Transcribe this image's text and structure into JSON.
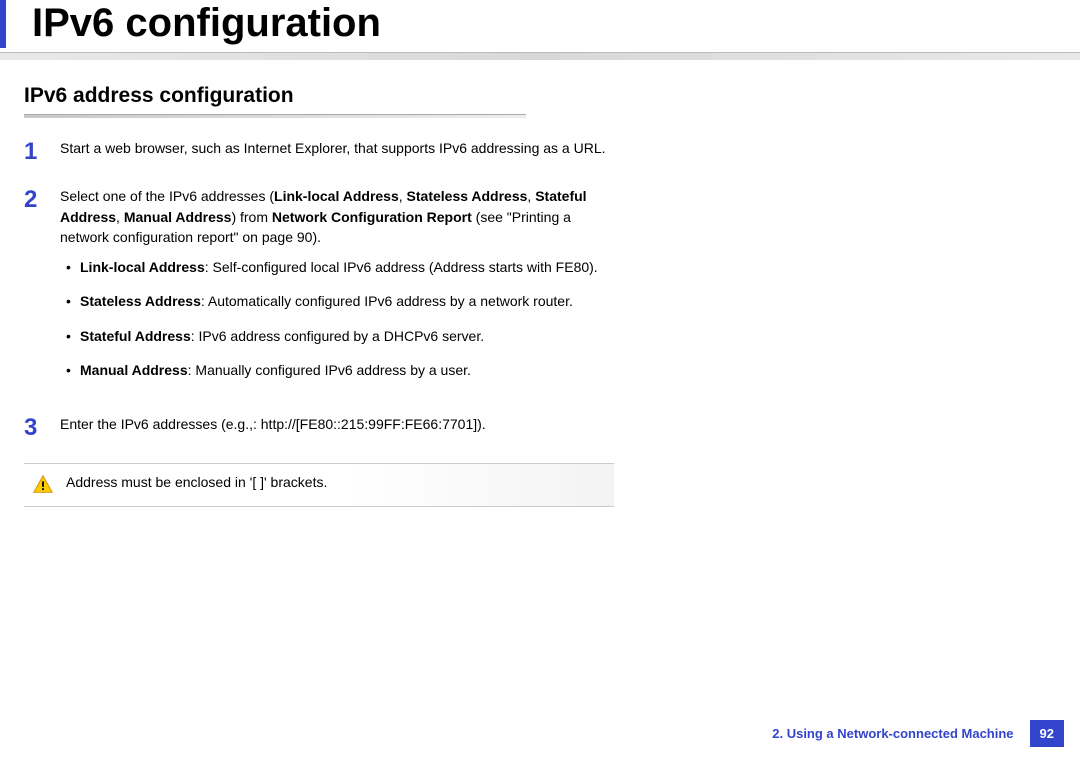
{
  "title": "IPv6 configuration",
  "section_heading": "IPv6 address configuration",
  "steps": {
    "s1": {
      "num": "1",
      "text": "Start a web browser, such as Internet Explorer, that supports IPv6 addressing as a URL."
    },
    "s2": {
      "num": "2",
      "lead_a": "Select one of the IPv6 addresses (",
      "bold1": "Link-local Address",
      "sep1": ", ",
      "bold2": "Stateless Address",
      "sep2": ", ",
      "bold3": "Stateful Address",
      "sep3": ", ",
      "bold4": "Manual Address",
      "lead_b": ") from ",
      "bold5": "Network Configuration Report",
      "tail": " (see \"Printing a network configuration report\" on page 90).",
      "bullets": {
        "b1_bold": "Link-local Address",
        "b1_rest": ": Self-configured local IPv6 address (Address starts with FE80).",
        "b2_bold": "Stateless Address",
        "b2_rest": ": Automatically configured IPv6 address by a network router.",
        "b3_bold": "Stateful Address",
        "b3_rest": ": IPv6 address configured by a DHCPv6 server.",
        "b4_bold": "Manual Address",
        "b4_rest": ": Manually configured IPv6 address by a user."
      }
    },
    "s3": {
      "num": "3",
      "text": "Enter the IPv6 addresses (e.g.,: http://[FE80::215:99FF:FE66:7701])."
    }
  },
  "note": "Address must be enclosed in '[ ]' brackets.",
  "footer": {
    "chapter": "2.  Using a Network-connected Machine",
    "page": "92"
  }
}
